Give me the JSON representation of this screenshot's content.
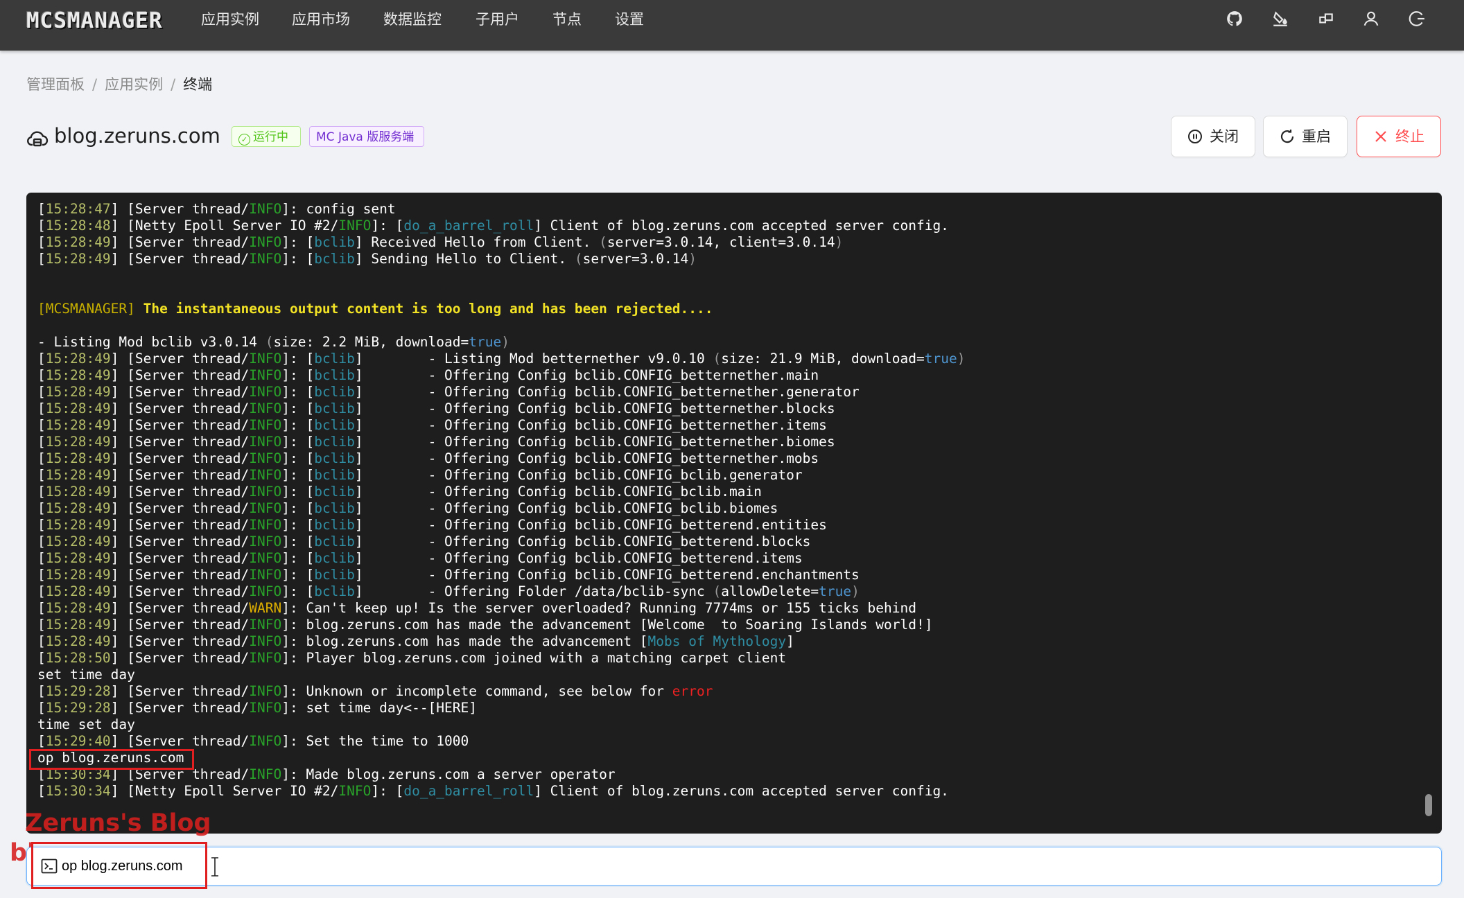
{
  "navbar": {
    "logo": "MCSMANAGER",
    "items": [
      "应用实例",
      "应用市场",
      "数据监控",
      "子用户",
      "节点",
      "设置"
    ],
    "icons": [
      "github-icon",
      "theme-icon",
      "layout-icon",
      "user-icon",
      "logout-icon"
    ]
  },
  "breadcrumb": {
    "items": [
      "管理面板",
      "应用实例",
      "终端"
    ],
    "separator": "/"
  },
  "instance": {
    "name": "blog.zeruns.com",
    "status": "运行中",
    "type": "MC Java 版服务端"
  },
  "actions": {
    "close": "关闭",
    "restart": "重启",
    "kill": "终止"
  },
  "colors": {
    "time": "#b5bd68",
    "info": "#29a329",
    "warn": "#e0b000",
    "tag": "#2f8ea3",
    "mcs": "#c8b000",
    "bold_yellow": "#f2e226",
    "bool": "#4e94ce",
    "error": "#ee2222",
    "white": "#ffffff",
    "gray": "#9a9a9a"
  },
  "terminal": {
    "lines": [
      [
        [
          "w",
          "["
        ],
        [
          "t",
          "15:28:47"
        ],
        [
          "w",
          "] [Server thread/"
        ],
        [
          "i",
          "INFO"
        ],
        [
          "w",
          "]: config sent"
        ]
      ],
      [
        [
          "w",
          "["
        ],
        [
          "t",
          "15:28:48"
        ],
        [
          "w",
          "] [Netty Epoll Server IO #2/"
        ],
        [
          "i",
          "INFO"
        ],
        [
          "w",
          "]: ["
        ],
        [
          "c",
          "do_a_barrel_roll"
        ],
        [
          "w",
          "] Client of blog.zeruns.com accepted server config."
        ]
      ],
      [
        [
          "w",
          "["
        ],
        [
          "t",
          "15:28:49"
        ],
        [
          "w",
          "] [Server thread/"
        ],
        [
          "i",
          "INFO"
        ],
        [
          "w",
          "]: ["
        ],
        [
          "c",
          "bclib"
        ],
        [
          "w",
          "] Received Hello from Client. "
        ],
        [
          "g",
          "("
        ],
        [
          "w",
          "server=3.0.14, client=3.0.14"
        ],
        [
          "g",
          ")"
        ]
      ],
      [
        [
          "w",
          "["
        ],
        [
          "t",
          "15:28:49"
        ],
        [
          "w",
          "] [Server thread/"
        ],
        [
          "i",
          "INFO"
        ],
        [
          "w",
          "]: ["
        ],
        [
          "c",
          "bclib"
        ],
        [
          "w",
          "] Sending Hello to Client. "
        ],
        [
          "g",
          "("
        ],
        [
          "w",
          "server=3.0.14"
        ],
        [
          "g",
          ")"
        ]
      ],
      [],
      [],
      [
        [
          "m",
          "[MCSMANAGER]"
        ],
        [
          "w",
          " "
        ],
        [
          "y",
          "The instantaneous output content is too long and has been rejected...."
        ]
      ],
      [],
      [
        [
          "w",
          "- Listing Mod bclib v3.0.14 "
        ],
        [
          "g",
          "("
        ],
        [
          "w",
          "size: 2.2 MiB, download="
        ],
        [
          "b",
          "true"
        ],
        [
          "g",
          ")"
        ]
      ],
      [
        [
          "w",
          "["
        ],
        [
          "t",
          "15:28:49"
        ],
        [
          "w",
          "] [Server thread/"
        ],
        [
          "i",
          "INFO"
        ],
        [
          "w",
          "]: ["
        ],
        [
          "c",
          "bclib"
        ],
        [
          "w",
          "]        - Listing Mod betternether v9.0.10 "
        ],
        [
          "g",
          "("
        ],
        [
          "w",
          "size: 21.9 MiB, download="
        ],
        [
          "b",
          "true"
        ],
        [
          "g",
          ")"
        ]
      ],
      [
        [
          "w",
          "["
        ],
        [
          "t",
          "15:28:49"
        ],
        [
          "w",
          "] [Server thread/"
        ],
        [
          "i",
          "INFO"
        ],
        [
          "w",
          "]: ["
        ],
        [
          "c",
          "bclib"
        ],
        [
          "w",
          "]        - Offering Config bclib.CONFIG_betternether.main"
        ]
      ],
      [
        [
          "w",
          "["
        ],
        [
          "t",
          "15:28:49"
        ],
        [
          "w",
          "] [Server thread/"
        ],
        [
          "i",
          "INFO"
        ],
        [
          "w",
          "]: ["
        ],
        [
          "c",
          "bclib"
        ],
        [
          "w",
          "]        - Offering Config bclib.CONFIG_betternether.generator"
        ]
      ],
      [
        [
          "w",
          "["
        ],
        [
          "t",
          "15:28:49"
        ],
        [
          "w",
          "] [Server thread/"
        ],
        [
          "i",
          "INFO"
        ],
        [
          "w",
          "]: ["
        ],
        [
          "c",
          "bclib"
        ],
        [
          "w",
          "]        - Offering Config bclib.CONFIG_betternether.blocks"
        ]
      ],
      [
        [
          "w",
          "["
        ],
        [
          "t",
          "15:28:49"
        ],
        [
          "w",
          "] [Server thread/"
        ],
        [
          "i",
          "INFO"
        ],
        [
          "w",
          "]: ["
        ],
        [
          "c",
          "bclib"
        ],
        [
          "w",
          "]        - Offering Config bclib.CONFIG_betternether.items"
        ]
      ],
      [
        [
          "w",
          "["
        ],
        [
          "t",
          "15:28:49"
        ],
        [
          "w",
          "] [Server thread/"
        ],
        [
          "i",
          "INFO"
        ],
        [
          "w",
          "]: ["
        ],
        [
          "c",
          "bclib"
        ],
        [
          "w",
          "]        - Offering Config bclib.CONFIG_betternether.biomes"
        ]
      ],
      [
        [
          "w",
          "["
        ],
        [
          "t",
          "15:28:49"
        ],
        [
          "w",
          "] [Server thread/"
        ],
        [
          "i",
          "INFO"
        ],
        [
          "w",
          "]: ["
        ],
        [
          "c",
          "bclib"
        ],
        [
          "w",
          "]        - Offering Config bclib.CONFIG_betternether.mobs"
        ]
      ],
      [
        [
          "w",
          "["
        ],
        [
          "t",
          "15:28:49"
        ],
        [
          "w",
          "] [Server thread/"
        ],
        [
          "i",
          "INFO"
        ],
        [
          "w",
          "]: ["
        ],
        [
          "c",
          "bclib"
        ],
        [
          "w",
          "]        - Offering Config bclib.CONFIG_bclib.generator"
        ]
      ],
      [
        [
          "w",
          "["
        ],
        [
          "t",
          "15:28:49"
        ],
        [
          "w",
          "] [Server thread/"
        ],
        [
          "i",
          "INFO"
        ],
        [
          "w",
          "]: ["
        ],
        [
          "c",
          "bclib"
        ],
        [
          "w",
          "]        - Offering Config bclib.CONFIG_bclib.main"
        ]
      ],
      [
        [
          "w",
          "["
        ],
        [
          "t",
          "15:28:49"
        ],
        [
          "w",
          "] [Server thread/"
        ],
        [
          "i",
          "INFO"
        ],
        [
          "w",
          "]: ["
        ],
        [
          "c",
          "bclib"
        ],
        [
          "w",
          "]        - Offering Config bclib.CONFIG_bclib.biomes"
        ]
      ],
      [
        [
          "w",
          "["
        ],
        [
          "t",
          "15:28:49"
        ],
        [
          "w",
          "] [Server thread/"
        ],
        [
          "i",
          "INFO"
        ],
        [
          "w",
          "]: ["
        ],
        [
          "c",
          "bclib"
        ],
        [
          "w",
          "]        - Offering Config bclib.CONFIG_betterend.entities"
        ]
      ],
      [
        [
          "w",
          "["
        ],
        [
          "t",
          "15:28:49"
        ],
        [
          "w",
          "] [Server thread/"
        ],
        [
          "i",
          "INFO"
        ],
        [
          "w",
          "]: ["
        ],
        [
          "c",
          "bclib"
        ],
        [
          "w",
          "]        - Offering Config bclib.CONFIG_betterend.blocks"
        ]
      ],
      [
        [
          "w",
          "["
        ],
        [
          "t",
          "15:28:49"
        ],
        [
          "w",
          "] [Server thread/"
        ],
        [
          "i",
          "INFO"
        ],
        [
          "w",
          "]: ["
        ],
        [
          "c",
          "bclib"
        ],
        [
          "w",
          "]        - Offering Config bclib.CONFIG_betterend.items"
        ]
      ],
      [
        [
          "w",
          "["
        ],
        [
          "t",
          "15:28:49"
        ],
        [
          "w",
          "] [Server thread/"
        ],
        [
          "i",
          "INFO"
        ],
        [
          "w",
          "]: ["
        ],
        [
          "c",
          "bclib"
        ],
        [
          "w",
          "]        - Offering Config bclib.CONFIG_betterend.enchantments"
        ]
      ],
      [
        [
          "w",
          "["
        ],
        [
          "t",
          "15:28:49"
        ],
        [
          "w",
          "] [Server thread/"
        ],
        [
          "i",
          "INFO"
        ],
        [
          "w",
          "]: ["
        ],
        [
          "c",
          "bclib"
        ],
        [
          "w",
          "]        - Offering Folder /data/bclib-sync "
        ],
        [
          "g",
          "("
        ],
        [
          "w",
          "allowDelete="
        ],
        [
          "b",
          "true"
        ],
        [
          "g",
          ")"
        ]
      ],
      [
        [
          "w",
          "["
        ],
        [
          "t",
          "15:28:49"
        ],
        [
          "w",
          "] [Server thread/"
        ],
        [
          "k",
          "WARN"
        ],
        [
          "w",
          "]: Can't keep up! Is the server overloaded? Running 7774ms or 155 ticks behind"
        ]
      ],
      [
        [
          "w",
          "["
        ],
        [
          "t",
          "15:28:49"
        ],
        [
          "w",
          "] [Server thread/"
        ],
        [
          "i",
          "INFO"
        ],
        [
          "w",
          "]: blog.zeruns.com has made the advancement [Welcome  to Soaring Islands world!]"
        ]
      ],
      [
        [
          "w",
          "["
        ],
        [
          "t",
          "15:28:49"
        ],
        [
          "w",
          "] [Server thread/"
        ],
        [
          "i",
          "INFO"
        ],
        [
          "w",
          "]: blog.zeruns.com has made the advancement ["
        ],
        [
          "c",
          "Mobs of Mythology"
        ],
        [
          "w",
          "]"
        ]
      ],
      [
        [
          "w",
          "["
        ],
        [
          "t",
          "15:28:50"
        ],
        [
          "w",
          "] [Server thread/"
        ],
        [
          "i",
          "INFO"
        ],
        [
          "w",
          "]: Player blog.zeruns.com joined with a matching carpet client"
        ]
      ],
      [
        [
          "w",
          "set time day"
        ]
      ],
      [
        [
          "w",
          "["
        ],
        [
          "t",
          "15:29:28"
        ],
        [
          "w",
          "] [Server thread/"
        ],
        [
          "i",
          "INFO"
        ],
        [
          "w",
          "]: Unknown or incomplete command, see below for "
        ],
        [
          "e",
          "error"
        ]
      ],
      [
        [
          "w",
          "["
        ],
        [
          "t",
          "15:29:28"
        ],
        [
          "w",
          "] [Server thread/"
        ],
        [
          "i",
          "INFO"
        ],
        [
          "w",
          "]: set time day<--[HERE]"
        ]
      ],
      [
        [
          "w",
          "time set day"
        ]
      ],
      [
        [
          "w",
          "["
        ],
        [
          "t",
          "15:29:40"
        ],
        [
          "w",
          "] [Server thread/"
        ],
        [
          "i",
          "INFO"
        ],
        [
          "w",
          "]: Set the time to 1000"
        ]
      ],
      [
        [
          "w",
          "op blog.zeruns.com"
        ]
      ],
      [
        [
          "w",
          "["
        ],
        [
          "t",
          "15:30:34"
        ],
        [
          "w",
          "] [Server thread/"
        ],
        [
          "i",
          "INFO"
        ],
        [
          "w",
          "]: Made blog.zeruns.com a server operator"
        ]
      ],
      [
        [
          "w",
          "["
        ],
        [
          "t",
          "15:30:34"
        ],
        [
          "w",
          "] [Netty Epoll Server IO #2/"
        ],
        [
          "i",
          "INFO"
        ],
        [
          "w",
          "]: ["
        ],
        [
          "c",
          "do_a_barrel_roll"
        ],
        [
          "w",
          "] Client of blog.zeruns.com accepted server config."
        ]
      ]
    ]
  },
  "command": {
    "value": "op blog.zeruns.com"
  },
  "watermark": {
    "line1": "Zeruns's Blog",
    "line2": "blog.zeruns.com"
  }
}
